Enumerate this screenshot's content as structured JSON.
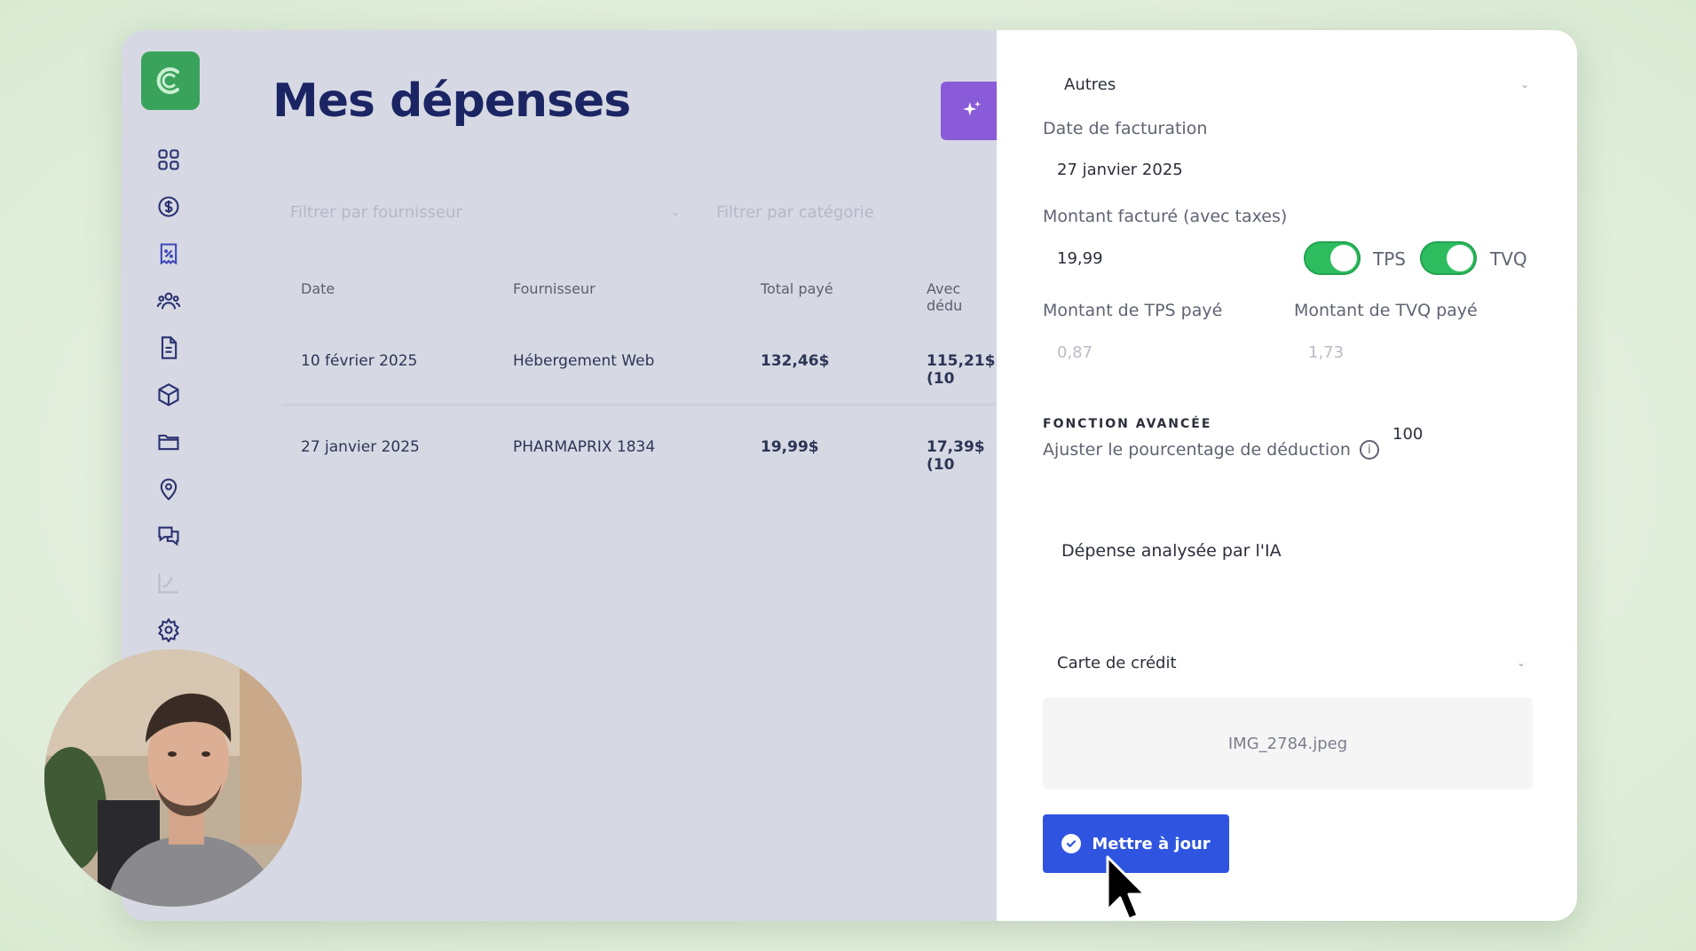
{
  "page": {
    "title": "Mes dépenses"
  },
  "sidebar": {
    "icons": [
      "dashboard-icon",
      "dollar-icon",
      "receipt-percent-icon",
      "users-icon",
      "document-icon",
      "box-icon",
      "folder-icon",
      "location-icon",
      "chat-icon",
      "chart-icon",
      "gear-icon"
    ],
    "active": "receipt-percent-icon"
  },
  "filters": {
    "supplier_placeholder": "Filtrer par fournisseur",
    "category_placeholder": "Filtrer par catégorie"
  },
  "table": {
    "columns": [
      "Date",
      "Fournisseur",
      "Total payé",
      "Avec dédu"
    ],
    "rows": [
      {
        "date": "10 février 2025",
        "supplier": "Hébergement Web",
        "total": "132,46$",
        "deducted": "115,21$ (10"
      },
      {
        "date": "27 janvier 2025",
        "supplier": "PHARMAPRIX 1834",
        "total": "19,99$",
        "deducted": "17,39$ (10"
      }
    ]
  },
  "panel": {
    "category_value": "Autres",
    "invoice_date_label": "Date de facturation",
    "invoice_date_value": "27 janvier 2025",
    "amount_label": "Montant facturé (avec taxes)",
    "amount_value": "19,99",
    "tps_label": "TPS",
    "tvq_label": "TVQ",
    "tps_on": true,
    "tvq_on": true,
    "tps_paid_label": "Montant de TPS payé",
    "tps_paid_value": "0,87",
    "tvq_paid_label": "Montant de TVQ payé",
    "tvq_paid_value": "1,73",
    "advanced_title": "FONCTION AVANCÉE",
    "advanced_sub": "Ajuster le pourcentage de déduction",
    "deduction_value": "100",
    "ai_label": "Dépense analysée par l'IA",
    "payment_value": "Carte de crédit",
    "file_name": "IMG_2784.jpeg",
    "update_label": "Mettre à jour"
  },
  "colors": {
    "title": "#1c2563",
    "brand_green": "#3aa35b",
    "ai_purple": "#8a5bd8",
    "primary_blue": "#2f55e0",
    "toggle_green": "#2dbd5e"
  }
}
